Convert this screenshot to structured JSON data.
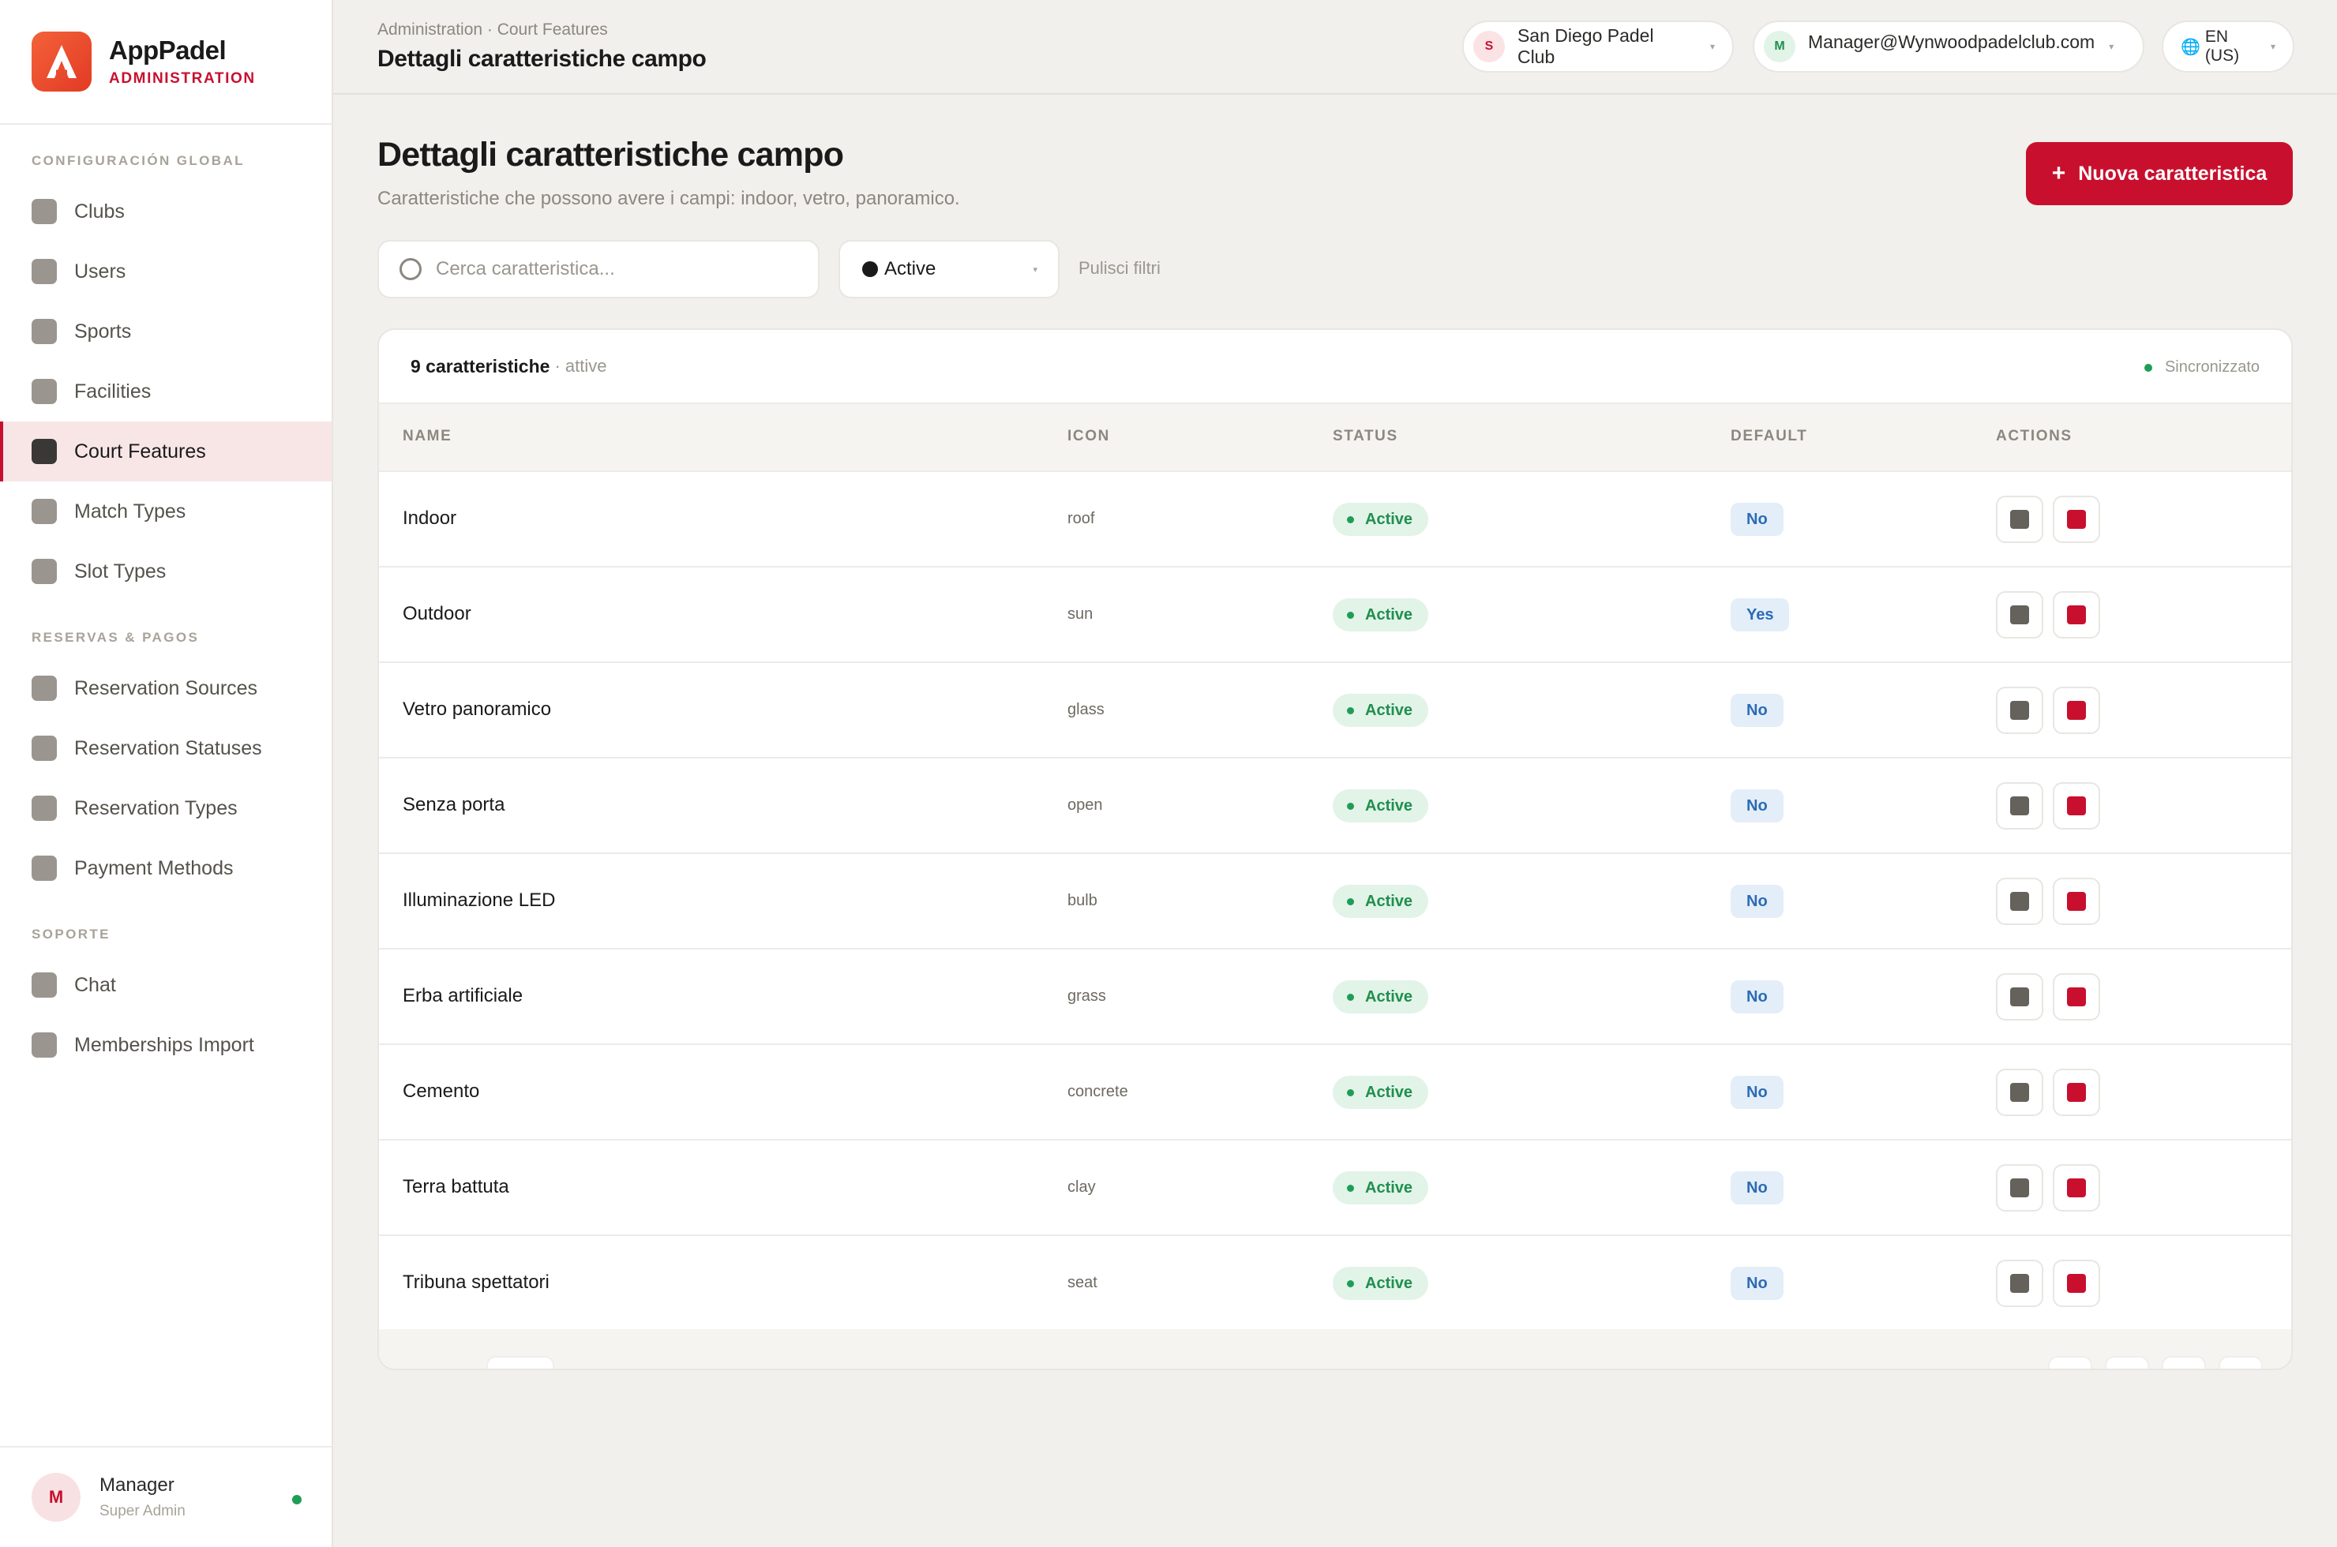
{
  "brand": {
    "name": "AppPadel",
    "subtitle": "ADMINISTRATION"
  },
  "sidebar": {
    "sections": [
      {
        "title": "CONFIGURACIÓN GLOBAL"
      },
      {
        "title": "RESERVAS & PAGOS"
      },
      {
        "title": "SOPORTE"
      }
    ],
    "items": [
      {
        "label": "Clubs"
      },
      {
        "label": "Users"
      },
      {
        "label": "Sports"
      },
      {
        "label": "Facilities"
      },
      {
        "label": "Court Features",
        "active": true
      },
      {
        "label": "Match Types"
      },
      {
        "label": "Slot Types"
      },
      {
        "label": "Reservation Sources"
      },
      {
        "label": "Reservation Statuses"
      },
      {
        "label": "Reservation Types"
      },
      {
        "label": "Payment Methods"
      },
      {
        "label": "Chat"
      },
      {
        "label": "Memberships Import"
      }
    ],
    "user": {
      "initial": "M",
      "name": "Manager",
      "role": "Super Admin"
    }
  },
  "header": {
    "breadcrumb": "Administration · Court Features",
    "title": "Dettagli caratteristiche campo",
    "club": {
      "initial": "S",
      "label": "San Diego Padel Club"
    },
    "account": {
      "initial": "M",
      "label": "Manager@Wynwoodpadelclub.com"
    },
    "language": "EN (US)"
  },
  "main": {
    "title": "Dettagli caratteristiche campo",
    "subtitle": "Caratteristiche che possono avere i campi: indoor, vetro, panoramico.",
    "new_button": "Nuova caratteristica",
    "search_placeholder": "Cerca caratteristica...",
    "filter_value": "Active",
    "clear_filters": "Pulisci filtri"
  },
  "table": {
    "count_label": "9 caratteristiche",
    "count_sub": "· attive",
    "sync_label": "Sincronizzato",
    "columns": [
      "NAME",
      "ICON",
      "STATUS",
      "DEFAULT",
      "ACTIONS"
    ],
    "rows": [
      {
        "name": "Indoor",
        "icon": "roof",
        "status": "Active",
        "default": "No"
      },
      {
        "name": "Outdoor",
        "icon": "sun",
        "status": "Active",
        "default": "Yes"
      },
      {
        "name": "Vetro panoramico",
        "icon": "glass",
        "status": "Active",
        "default": "No"
      },
      {
        "name": "Senza porta",
        "icon": "open",
        "status": "Active",
        "default": "No"
      },
      {
        "name": "Illuminazione LED",
        "icon": "bulb",
        "status": "Active",
        "default": "No"
      },
      {
        "name": "Erba artificiale",
        "icon": "grass",
        "status": "Active",
        "default": "No"
      },
      {
        "name": "Cemento",
        "icon": "concrete",
        "status": "Active",
        "default": "No"
      },
      {
        "name": "Terra battuta",
        "icon": "clay",
        "status": "Active",
        "default": "No"
      },
      {
        "name": "Tribuna spettatori",
        "icon": "seat",
        "status": "Active",
        "default": "No"
      }
    ]
  },
  "colors": {
    "accent": "#c8102e",
    "success": "#1f9d55",
    "info": "#2c6bb5"
  }
}
